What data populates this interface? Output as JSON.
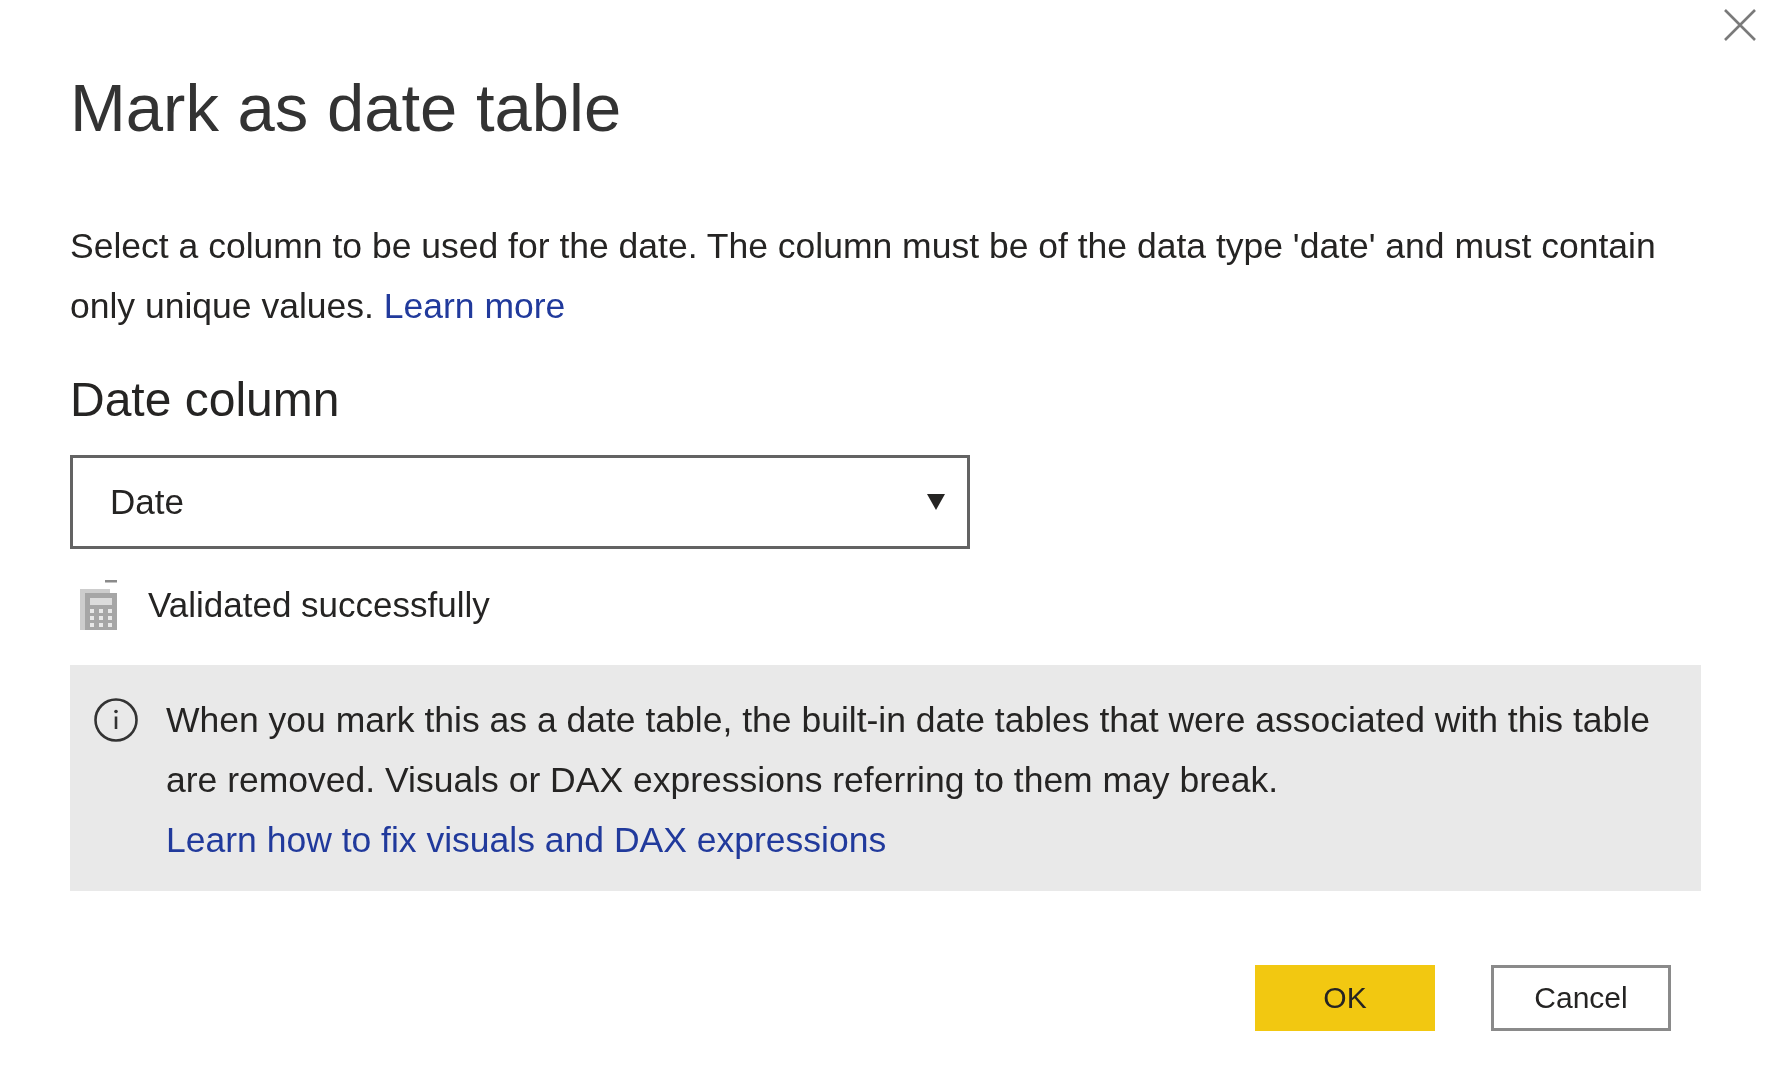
{
  "dialog": {
    "title": "Mark as date table",
    "description": {
      "text": "Select a column to be used for the date. The column must be of the data type 'date' and must contain only unique values.",
      "link": "Learn more"
    },
    "field": {
      "label": "Date column",
      "value": "Date"
    },
    "validation": {
      "text": "Validated successfully"
    },
    "notice": {
      "text": "When you mark this as a date table, the built-in date tables that were associated with this table are removed. Visuals or DAX expressions referring to them may break.",
      "link": "Learn how to fix visuals and DAX expressions"
    },
    "buttons": [
      {
        "label": "OK",
        "kind": "primary"
      },
      {
        "label": "Cancel",
        "kind": "secondary"
      }
    ]
  }
}
